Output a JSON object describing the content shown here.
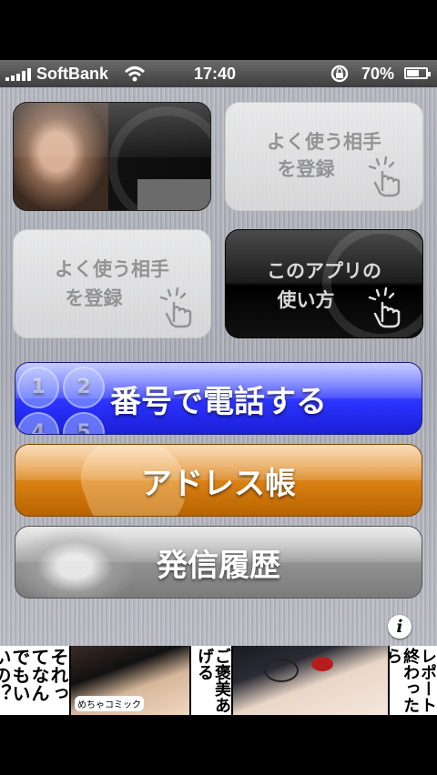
{
  "status_bar": {
    "carrier": "SoftBank",
    "time": "17:40",
    "battery_percent": "70%",
    "battery_level": 0.7
  },
  "tiles": {
    "favorite_1": {
      "label_line1": "よく使う相手",
      "label_line2": "を登録"
    },
    "favorite_2": {
      "label_line1": "よく使う相手",
      "label_line2": "を登録"
    },
    "how_to": {
      "label_line1": "このアプリの",
      "label_line2": "使い方"
    }
  },
  "buttons": {
    "dial": "番号で電話する",
    "address_book": "アドレス帳",
    "call_history": "発信履歴",
    "keypad_digits": [
      "1",
      "2",
      "4",
      "5"
    ]
  },
  "info_button": "i",
  "banner": {
    "panel1_text": "それってなんでもいいの？",
    "panel2_caption": "めちゃコミック",
    "panel3_text": "ご褒美あげる",
    "panel5_text": "レポート終わったら"
  }
}
